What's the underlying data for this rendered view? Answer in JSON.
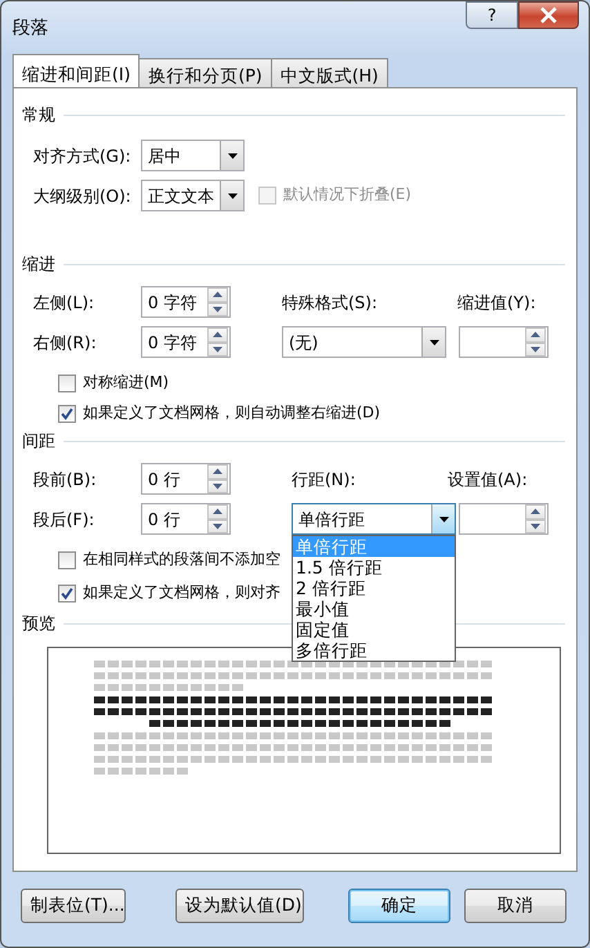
{
  "window": {
    "title": "段落",
    "help": "?"
  },
  "tabs": [
    {
      "label": "缩进和间距(I)",
      "selected": true
    },
    {
      "label": "换行和分页(P)",
      "selected": false
    },
    {
      "label": "中文版式(H)",
      "selected": false
    }
  ],
  "general": {
    "title": "常规",
    "alignment": {
      "label": "对齐方式(G):",
      "value": "居中"
    },
    "outline_level": {
      "label": "大纲级别(O):",
      "value": "正文文本"
    },
    "collapse": {
      "label": "默认情况下折叠(E)",
      "checked": false,
      "disabled": true
    }
  },
  "indent": {
    "title": "缩进",
    "left": {
      "label": "左侧(L):",
      "value": "0 字符"
    },
    "right": {
      "label": "右侧(R):",
      "value": "0 字符"
    },
    "special": {
      "label": "特殊格式(S):",
      "value": "(无)"
    },
    "by": {
      "label": "缩进值(Y):"
    },
    "mirror": {
      "label": "对称缩进(M)",
      "checked": false,
      "disabled": false
    },
    "auto_adjust": {
      "label": "如果定义了文档网格，则自动调整右缩进(D)",
      "checked": true,
      "disabled": false
    }
  },
  "spacing": {
    "title": "间距",
    "before": {
      "label": "段前(B):",
      "value": "0 行"
    },
    "after": {
      "label": "段后(F):",
      "value": "0 行"
    },
    "line_spacing": {
      "label": "行距(N):",
      "value": "单倍行距",
      "expanded": true,
      "options": [
        {
          "label": "单倍行距",
          "selected": true
        },
        {
          "label": "1.5 倍行距",
          "selected": false
        },
        {
          "label": "2 倍行距",
          "selected": false
        },
        {
          "label": "最小值",
          "selected": false
        },
        {
          "label": "固定值",
          "selected": false
        },
        {
          "label": "多倍行距",
          "selected": false
        }
      ]
    },
    "at": {
      "label": "设置值(A):"
    },
    "no_space": {
      "label": "在相同样式的段落间不添加空",
      "checked": false,
      "disabled": false
    },
    "snap": {
      "label": "如果定义了文档网格，则对齐",
      "checked": true,
      "disabled": false
    }
  },
  "preview": {
    "title": "预览"
  },
  "buttons": [
    {
      "label": "制表位(T)...",
      "default": false
    },
    {
      "label": "设为默认值(D)",
      "default": false
    },
    {
      "label": "确定",
      "default": true
    },
    {
      "label": "取消",
      "default": false
    }
  ]
}
